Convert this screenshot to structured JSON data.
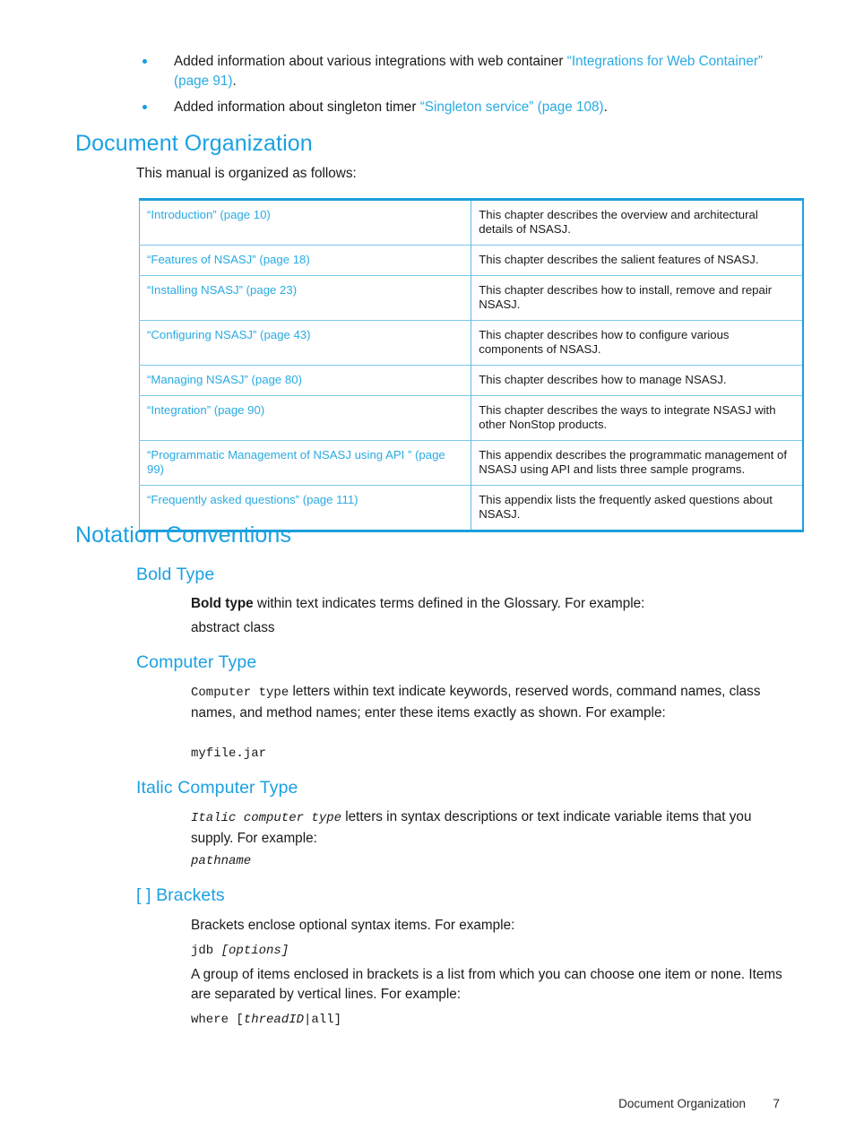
{
  "bullets": [
    {
      "text_before": "Added information about various integrations with web container ",
      "link": "“Integrations for Web Container” (page 91)",
      "text_after": "."
    },
    {
      "text_before": "Added information about singleton timer ",
      "link": "“Singleton service” (page 108)",
      "text_after": "."
    }
  ],
  "document_organization": {
    "heading": "Document Organization",
    "intro": "This manual is organized as follows:",
    "table": {
      "rows": [
        {
          "chapter": "“Introduction” (page 10)",
          "description": "This chapter describes the overview and architectural details of NSASJ."
        },
        {
          "chapter": "“Features of NSASJ” (page 18)",
          "description": "This chapter describes the salient features of NSASJ."
        },
        {
          "chapter": "“Installing NSASJ” (page 23)",
          "description": "This chapter describes how to install, remove and repair NSASJ."
        },
        {
          "chapter": "“Configuring NSASJ” (page 43)",
          "description": "This chapter describes how to configure various components of NSASJ."
        },
        {
          "chapter": "“Managing NSASJ” (page 80)",
          "description": "This chapter describes how to manage NSASJ."
        },
        {
          "chapter": "“Integration” (page 90)",
          "description": "This chapter describes the ways to integrate NSASJ with other NonStop products."
        },
        {
          "chapter": "“Programmatic Management of NSASJ using API ” (page 99)",
          "description": "This appendix describes the programmatic management of NSASJ using API and lists three sample programs."
        },
        {
          "chapter": "“Frequently asked questions” (page 111)",
          "description": "This appendix lists the frequently asked questions about NSASJ."
        }
      ]
    }
  },
  "notation_conventions": {
    "heading": "Notation Conventions",
    "bold_type": {
      "heading": "Bold Type",
      "term": "Bold type",
      "body": " within text indicates terms defined in the Glossary. For example:",
      "example": "abstract class"
    },
    "computer_type": {
      "heading": "Computer Type",
      "term": "Computer type",
      "body": " letters within text indicate keywords, reserved words, command names, class names, and method names; enter these items exactly as shown. For example:",
      "example": "myfile.jar"
    },
    "italic_computer_type": {
      "heading": "Italic Computer Type",
      "term": "Italic computer type",
      "body": " letters in syntax descriptions or text indicate variable items that you supply. For example:",
      "example": "pathname"
    },
    "brackets": {
      "heading": "[ ] Brackets",
      "body1": "Brackets enclose optional syntax items. For example:",
      "example1_plain": "jdb ",
      "example1_italic": "[options]",
      "body2": "A group of items enclosed in brackets is a list from which you can choose one item or none. Items are separated by vertical lines. For example:",
      "example2_plain_a": "where [",
      "example2_italic": "threadID",
      "example2_plain_b": "|all]"
    }
  },
  "footer": {
    "section": "Document Organization",
    "page_number": "7"
  },
  "colors": {
    "heading_blue": "#1ba1e2",
    "link_blue": "#29abe2",
    "table_border_strong": "#1d9fdc",
    "table_border_light": "#7cc7ea",
    "text": "#1a1a1a"
  }
}
